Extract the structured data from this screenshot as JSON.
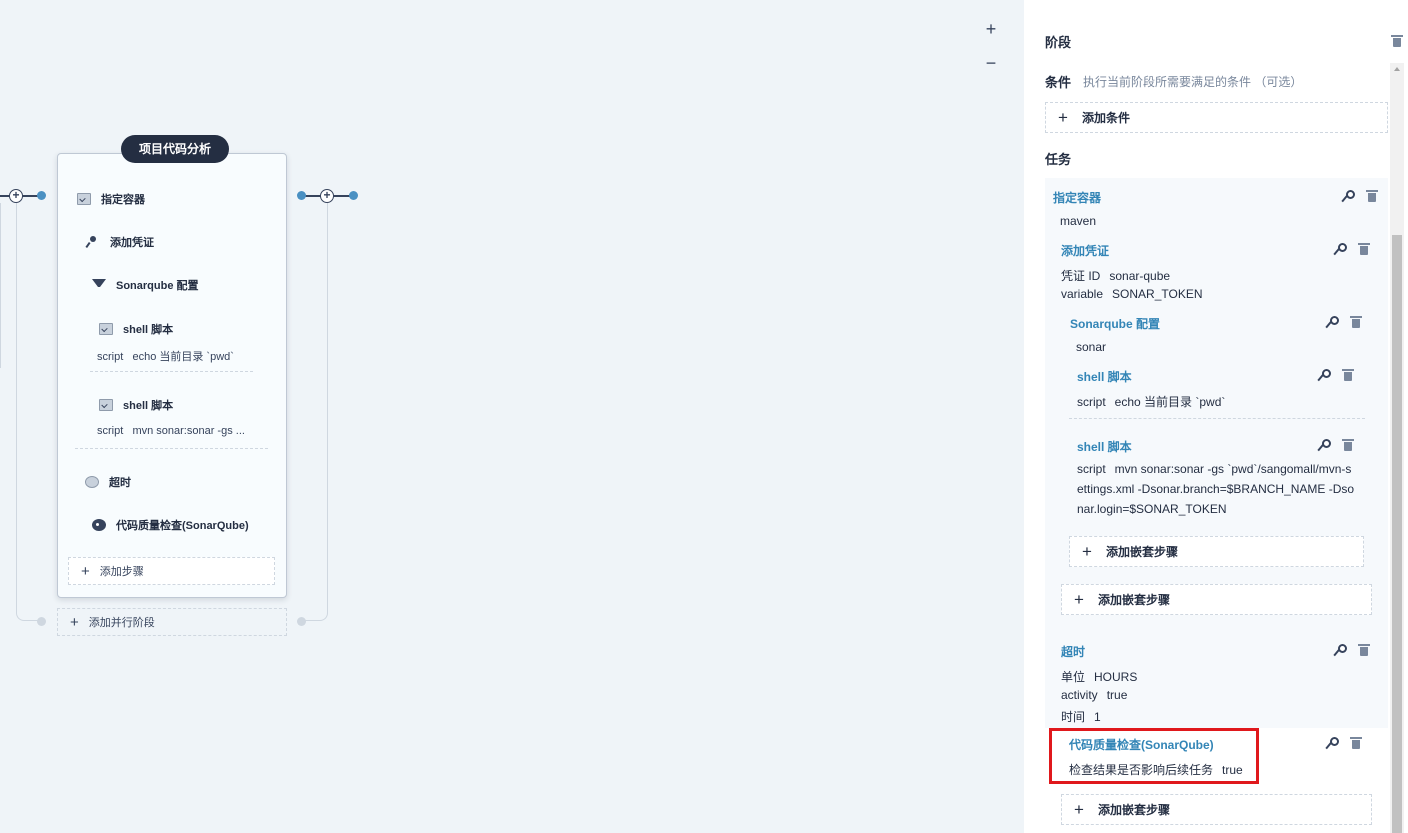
{
  "canvas": {
    "zoom_in": "+",
    "zoom_out": "−",
    "stage": {
      "title": "项目代码分析",
      "steps": [
        {
          "label": "指定容器",
          "icon": "container-icon"
        },
        {
          "label": "添加凭证",
          "icon": "key-icon"
        },
        {
          "label": "Sonarqube 配置",
          "icon": "sonarqube-icon"
        },
        {
          "label": "shell 脚本",
          "icon": "terminal-icon",
          "sub_key": "script",
          "sub_value": "echo 当前目录 `pwd`"
        },
        {
          "label": "shell 脚本",
          "icon": "terminal-icon",
          "sub_key": "script",
          "sub_value": "mvn sonar:sonar -gs ..."
        },
        {
          "label": "超时",
          "icon": "clock-icon"
        },
        {
          "label": "代码质量检查(SonarQube)",
          "icon": "quality-check-icon"
        }
      ],
      "add_step": "添加步骤",
      "add_parallel": "添加并行阶段"
    }
  },
  "panel": {
    "stage_heading": "阶段",
    "condition_heading": "条件",
    "condition_hint": "执行当前阶段所需要满足的条件 （可选）",
    "add_condition": "添加条件",
    "tasks_heading": "任务",
    "tasks": {
      "container": {
        "title": "指定容器",
        "value": "maven"
      },
      "credential": {
        "title": "添加凭证",
        "fields": [
          {
            "k": "凭证 ID",
            "v": "sonar-qube"
          },
          {
            "k": "variable",
            "v": "SONAR_TOKEN"
          }
        ]
      },
      "sonar": {
        "title": "Sonarqube 配置",
        "value": "sonar"
      },
      "shell1": {
        "title": "shell 脚本",
        "k": "script",
        "v": "echo 当前目录 `pwd`"
      },
      "shell2": {
        "title": "shell 脚本",
        "k": "script",
        "lines": [
          "mvn sonar:sonar -gs `pwd`/sangomall/mvn-s",
          "ettings.xml -Dsonar.branch=$BRANCH_NAME -Dso",
          "nar.login=$SONAR_TOKEN"
        ]
      },
      "add_nested_inner": "添加嵌套步骤",
      "add_nested_outer": "添加嵌套步骤",
      "timeout": {
        "title": "超时",
        "fields": [
          {
            "k": "单位",
            "v": "HOURS"
          },
          {
            "k": "activity",
            "v": "true"
          },
          {
            "k": "时间",
            "v": "1"
          }
        ]
      },
      "quality": {
        "title": "代码质量检查(SonarQube)",
        "k": "检查结果是否影响后续任务",
        "v": "true"
      },
      "add_nested_bottom": "添加嵌套步骤"
    }
  }
}
